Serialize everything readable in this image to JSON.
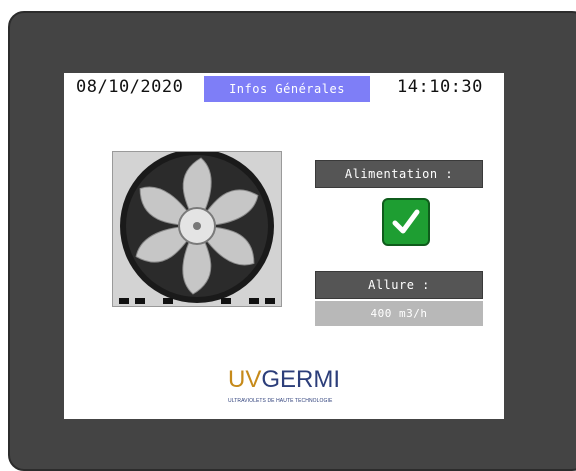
{
  "header": {
    "date": "08/10/2020",
    "title": "Infos Générales",
    "time": "14:10:30"
  },
  "power": {
    "label": "Alimentation :",
    "status": "on",
    "status_icon": "check-icon",
    "status_color": "#1e9e32"
  },
  "airflow": {
    "label": "Allure :",
    "value": "400 m3/h"
  },
  "logo": {
    "uv": "UV",
    "brand": "GERMI",
    "tagline": "ULTRAVIOLETS DE HAUTE TECHNOLOGIE"
  },
  "colors": {
    "accent": "#7e7ef7",
    "label_bg": "#555555",
    "value_bg": "#b8b8b8",
    "bezel": "#444444"
  }
}
